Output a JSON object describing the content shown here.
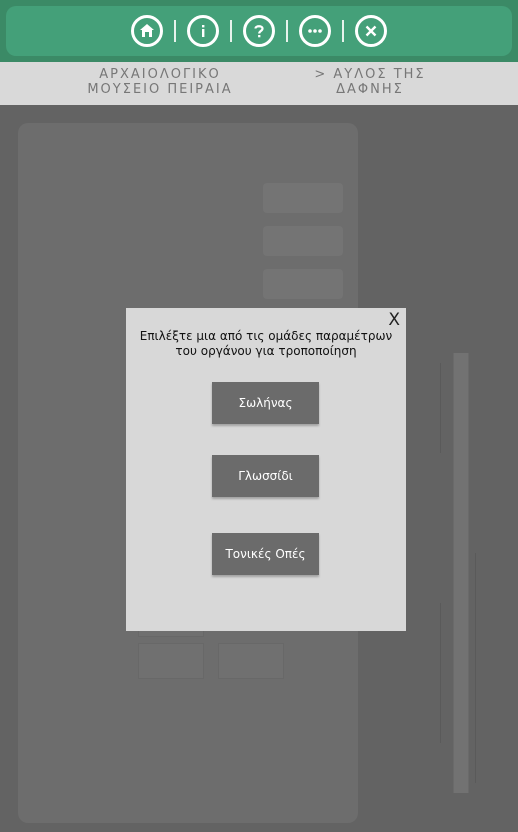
{
  "toolbar": {
    "icons": [
      "home-icon",
      "info-icon",
      "help-icon",
      "more-icon",
      "close-icon"
    ]
  },
  "breadcrumb": {
    "museum_line1": "ΑΡΧΑΙΟΛΟΓΙΚΟ",
    "museum_line2": "ΜΟΥΣΕΙΟ ΠΕΙΡΑΙΑ",
    "current_line1": "> ΑΥΛΟΣ ΤΗΣ",
    "current_line2": "ΔΑΦΝΗΣ"
  },
  "dialog": {
    "close_label": "X",
    "message": "Επιλέξτε μια από τις ομάδες παραμέτρων του οργάνου για τροποποίηση",
    "buttons": [
      "Σωλήνας",
      "Γλωσσίδι",
      "Τονικές Οπές"
    ]
  },
  "colors": {
    "toolbar": "#3b8a66",
    "toolbar_inner": "#44a079",
    "overlay": "#5f5f5f",
    "dialog_bg": "#d8d8d8",
    "dialog_button": "#6b6b6b"
  }
}
